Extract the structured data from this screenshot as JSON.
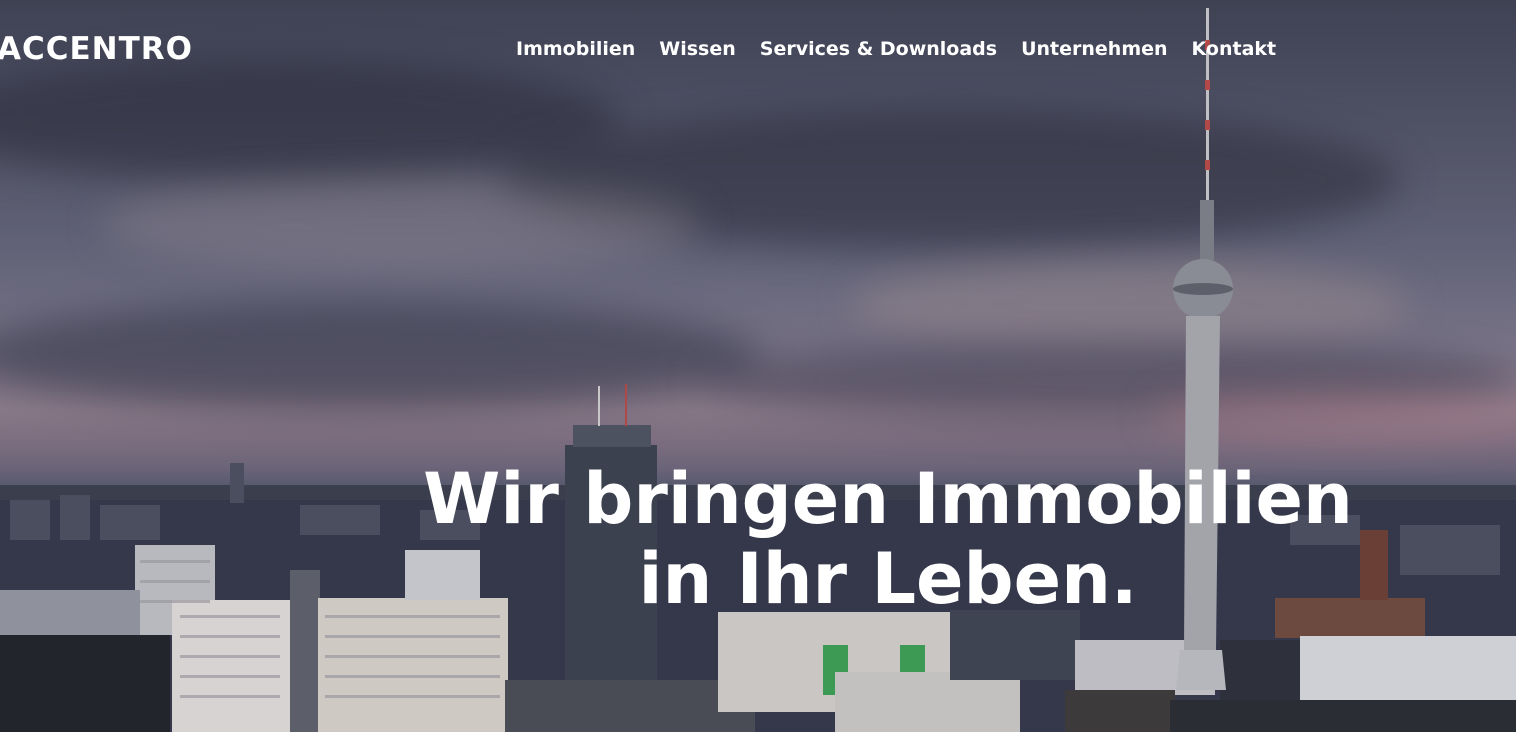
{
  "header": {
    "logo_text": "ACCENTRO"
  },
  "nav": {
    "items": [
      {
        "label": "Immobilien"
      },
      {
        "label": "Wissen"
      },
      {
        "label": "Services & Downloads"
      },
      {
        "label": "Unternehmen"
      },
      {
        "label": "Kontakt"
      }
    ]
  },
  "hero": {
    "headline_line1": "Wir bringen Immobilien",
    "headline_line2": "in Ihr Leben."
  },
  "colors": {
    "text": "#ffffff",
    "sky_top": "#3f4253",
    "horizon": "#8a7a89",
    "city": "#2d303b"
  }
}
